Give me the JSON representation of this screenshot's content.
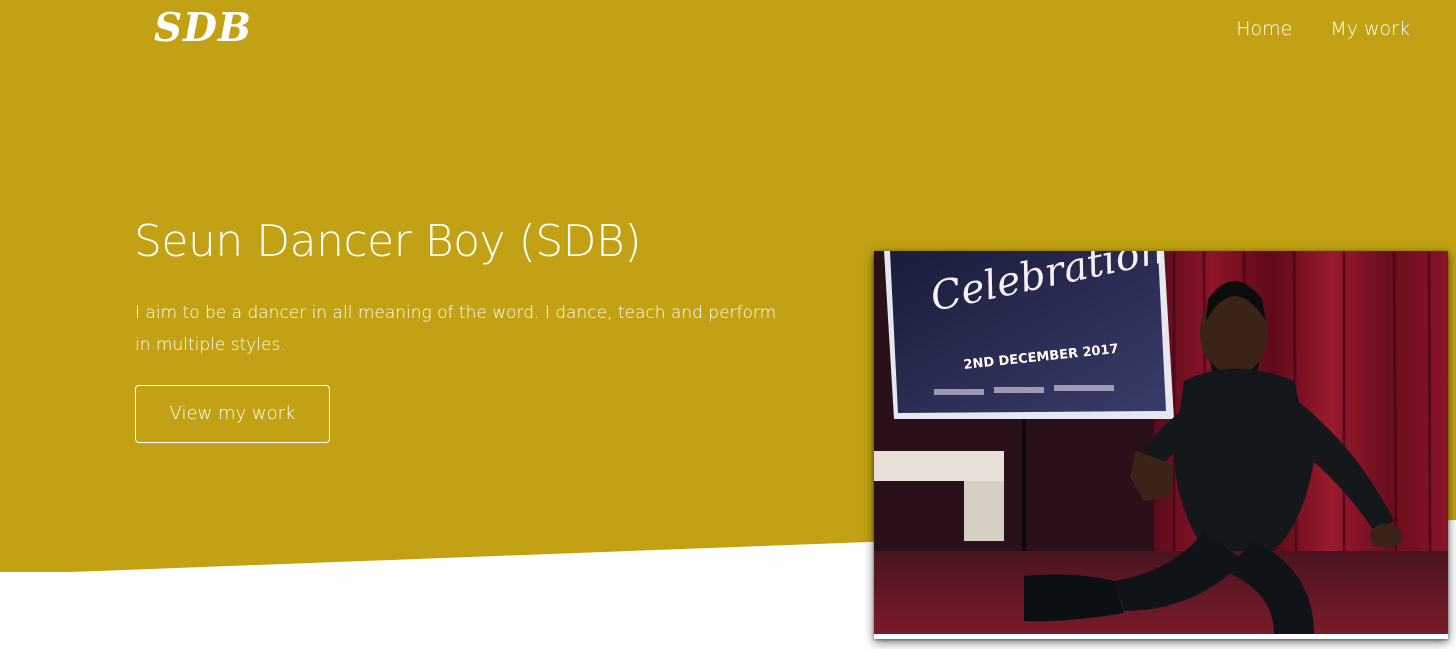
{
  "header": {
    "logo": "SDB",
    "nav": [
      {
        "label": "Home"
      },
      {
        "label": "My work"
      }
    ]
  },
  "hero": {
    "title": "Seun Dancer Boy (SDB)",
    "description": "I aim to be a dancer in all meaning of the word. I dance, teach and perform in multiple styles.",
    "button_label": "View my work",
    "photo": {
      "banner_script": "Celebration",
      "banner_date": "2ND DECEMBER 2017"
    }
  },
  "colors": {
    "hero_background": "#c2a214",
    "text": "#ffffff",
    "page_background": "#ffffff"
  }
}
